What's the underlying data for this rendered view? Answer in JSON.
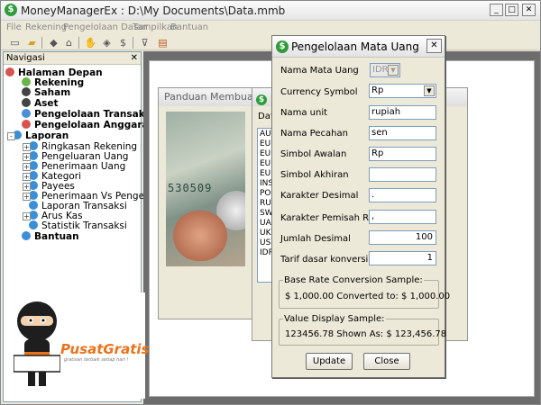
{
  "window": {
    "title": "MoneyManagerEx : D:\\My Documents\\Data.mmb"
  },
  "menu": [
    "File",
    "Rekening",
    "Pengelolaan Dasar",
    "Tampilkan",
    "Bantuan"
  ],
  "nav": {
    "header": "Navigasi",
    "items": [
      {
        "label": "Halaman Depan",
        "bold": true,
        "color": "#d9534f"
      },
      {
        "label": "Rekening",
        "bold": true,
        "color": "#6bb44a"
      },
      {
        "label": "Saham",
        "bold": true,
        "color": "#444444"
      },
      {
        "label": "Aset",
        "bold": true,
        "color": "#444444"
      },
      {
        "label": "Pengelolaan Transaksi Rutin",
        "bold": true,
        "color": "#4a90d9"
      },
      {
        "label": "Pengelolaan Anggaran",
        "bold": true,
        "color": "#d9534f"
      },
      {
        "label": "Laporan",
        "bold": true,
        "color": "#3a8fd6"
      },
      {
        "label": "Ringkasan Rekening",
        "bold": false,
        "color": "#3a8fd6"
      },
      {
        "label": "Pengeluaran Uang",
        "bold": false,
        "color": "#3a8fd6"
      },
      {
        "label": "Penerimaan Uang",
        "bold": false,
        "color": "#3a8fd6"
      },
      {
        "label": "Kategori",
        "bold": false,
        "color": "#3a8fd6"
      },
      {
        "label": "Payees",
        "bold": false,
        "color": "#3a8fd6"
      },
      {
        "label": "Penerimaan Vs Pengeluaran",
        "bold": false,
        "color": "#3a8fd6"
      },
      {
        "label": "Laporan Transaksi",
        "bold": false,
        "color": "#3a8fd6"
      },
      {
        "label": "Arus Kas",
        "bold": false,
        "color": "#3a8fd6"
      },
      {
        "label": "Statistik Transaksi",
        "bold": false,
        "color": "#3a8fd6"
      },
      {
        "label": "Bantuan",
        "bold": true,
        "color": "#3a8fd6"
      }
    ]
  },
  "bg_window": {
    "title": "Panduan Membuat Da",
    "bill_text": "530509"
  },
  "bg_dialog": {
    "title_partial": "Dafta",
    "list": [
      "AU",
      "EUR",
      "EUR",
      "EUR",
      "EUR",
      "INS",
      "POL",
      "RUB",
      "SWI",
      "UAH",
      "UK F",
      "US D",
      "IDR"
    ]
  },
  "dialog": {
    "title": "Pengelolaan Mata Uang",
    "fields": [
      {
        "label": "Nama Mata Uang",
        "value": "IDR"
      },
      {
        "label": "Currency Symbol",
        "value": "Rp"
      },
      {
        "label": "Nama unit",
        "value": "rupiah"
      },
      {
        "label": "Nama Pecahan",
        "value": "sen"
      },
      {
        "label": "Simbol Awalan",
        "value": "Rp"
      },
      {
        "label": "Simbol Akhiran",
        "value": ""
      },
      {
        "label": "Karakter Desimal",
        "value": "."
      },
      {
        "label": "Karakter Pemisah Ribuan",
        "value": ","
      },
      {
        "label": "Jumlah Desimal",
        "value": "100"
      },
      {
        "label": "Tarif dasar konversi",
        "value": "1"
      }
    ],
    "base_rate": {
      "title": "Base Rate Conversion Sample:",
      "text": "$ 1,000.00 Converted to: $ 1,000.00"
    },
    "value_display": {
      "title": "Value Display Sample:",
      "text": "123456.78 Shown As: $ 123,456.78"
    },
    "update_label": "Update",
    "close_label": "Close"
  },
  "logo": {
    "text": "PusatGratis",
    "sub": "gratisan terbaik setiap hari !"
  },
  "colors": {
    "accent_green": "#2e9c3a",
    "logo_orange": "#e8731a"
  }
}
